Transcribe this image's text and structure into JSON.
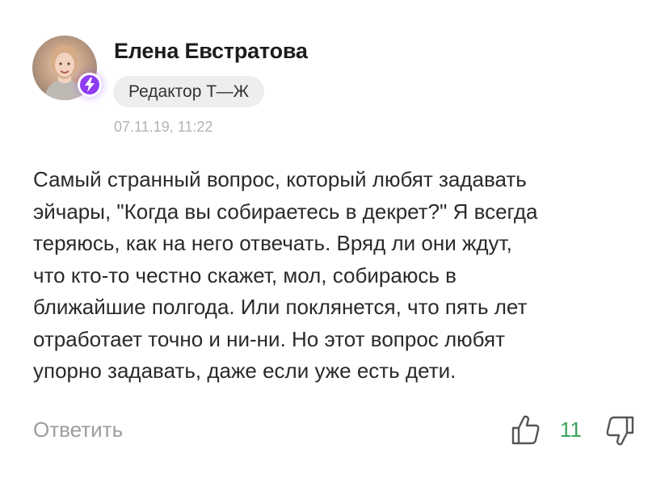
{
  "author": {
    "name": "Елена Евстратова",
    "role": "Редактор Т—Ж",
    "avatar_icon": "user-photo",
    "badge_icon": "lightning-icon",
    "badge_color": "#8f3bf2"
  },
  "comment": {
    "date": "07.11.19, 11:22",
    "lines": [
      "Самый странный вопрос, который любят задавать",
      "эйчары, \"Когда вы собираетесь в декрет?\" Я всегда",
      "теряюсь, как на него отвечать. Вряд ли они ждут,",
      "что кто-то честно скажет, мол, собираюсь в",
      "ближайшие полгода. Или поклянется, что пять лет",
      "отработает точно и ни-ни. Но этот вопрос любят",
      "упорно задавать, даже если уже есть дети."
    ]
  },
  "actions": {
    "reply_label": "Ответить",
    "like_count": "11",
    "like_color": "#3aa35a",
    "like_icon": "thumbs-up-icon",
    "dislike_icon": "thumbs-down-icon"
  }
}
